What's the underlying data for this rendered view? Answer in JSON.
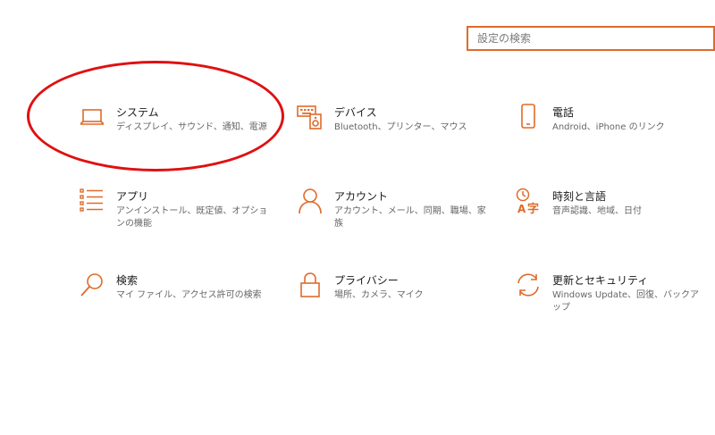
{
  "search": {
    "placeholder": "設定の検索",
    "value": ""
  },
  "accent_color": "#e06a2a",
  "annotation_color": "#e01010",
  "tiles": [
    {
      "id": "system",
      "icon": "laptop-icon",
      "title": "システム",
      "desc": "ディスプレイ、サウンド、通知、電源"
    },
    {
      "id": "devices",
      "icon": "keyboard-speaker-icon",
      "title": "デバイス",
      "desc": "Bluetooth、プリンター、マウス"
    },
    {
      "id": "phone",
      "icon": "phone-icon",
      "title": "電話",
      "desc": "Android、iPhone のリンク"
    },
    {
      "id": "apps",
      "icon": "app-list-icon",
      "title": "アプリ",
      "desc": "アンインストール、既定値、オプションの機能"
    },
    {
      "id": "accounts",
      "icon": "person-icon",
      "title": "アカウント",
      "desc": "アカウント、メール、同期、職場、家族"
    },
    {
      "id": "time-language",
      "icon": "language-icon",
      "title": "時刻と言語",
      "desc": "音声認識、地域、日付"
    },
    {
      "id": "search",
      "icon": "magnifier-icon",
      "title": "検索",
      "desc": "マイ ファイル、アクセス許可の検索"
    },
    {
      "id": "privacy",
      "icon": "lock-icon",
      "title": "プライバシー",
      "desc": "場所、カメラ、マイク"
    },
    {
      "id": "update-security",
      "icon": "sync-icon",
      "title": "更新とセキュリティ",
      "desc": "Windows Update、回復、バックアップ"
    }
  ]
}
